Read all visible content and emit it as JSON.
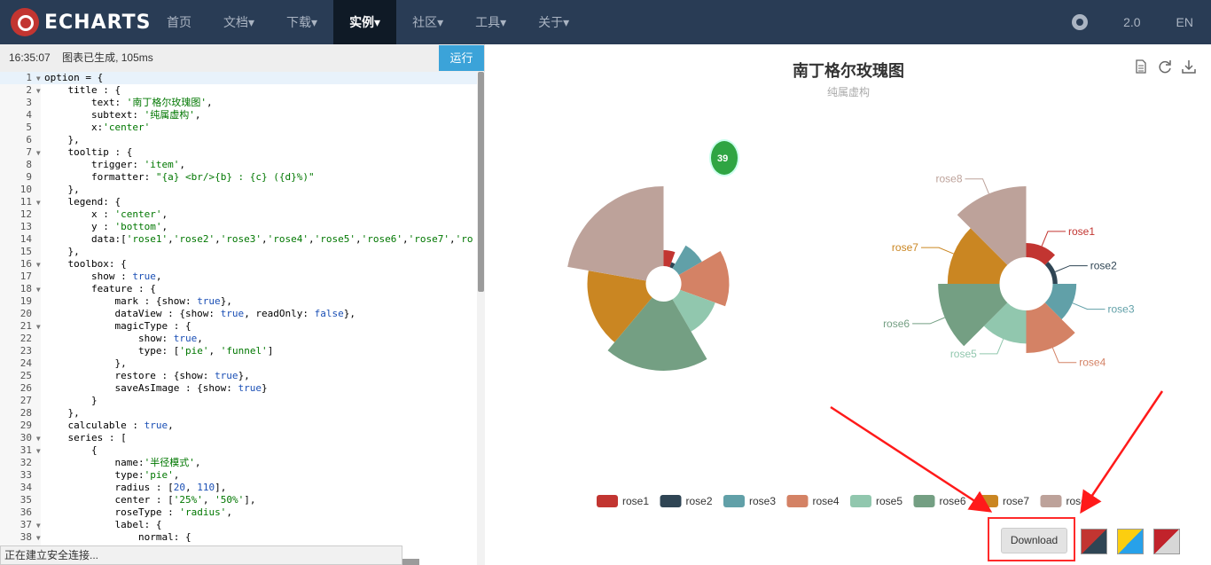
{
  "nav": {
    "logo": "ECHARTS",
    "items": [
      {
        "label": "首页",
        "active": false
      },
      {
        "label": "文档▾",
        "active": false
      },
      {
        "label": "下载▾",
        "active": false
      },
      {
        "label": "实例▾",
        "active": true
      },
      {
        "label": "社区▾",
        "active": false
      },
      {
        "label": "工具▾",
        "active": false
      },
      {
        "label": "关于▾",
        "active": false
      }
    ],
    "version": "2.0",
    "lang": "EN"
  },
  "editor": {
    "time": "16:35:07",
    "status": "图表已生成, 105ms",
    "run_label": "运行",
    "lines": [
      {
        "n": "1",
        "fold": true,
        "html": "option = {"
      },
      {
        "n": "2",
        "fold": true,
        "html": "    title : {"
      },
      {
        "n": "3",
        "fold": false,
        "html": "        text: <span class='s'>'南丁格尔玫瑰图'</span>,"
      },
      {
        "n": "4",
        "fold": false,
        "html": "        subtext: <span class='s'>'纯属虚构'</span>,"
      },
      {
        "n": "5",
        "fold": false,
        "html": "        x:<span class='s'>'center'</span>"
      },
      {
        "n": "6",
        "fold": false,
        "html": "    },"
      },
      {
        "n": "7",
        "fold": true,
        "html": "    tooltip : {"
      },
      {
        "n": "8",
        "fold": false,
        "html": "        trigger: <span class='s'>'item'</span>,"
      },
      {
        "n": "9",
        "fold": false,
        "html": "        formatter: <span class='s'>\"{a} &lt;br/&gt;{b} : {c} ({d}%)\"</span>"
      },
      {
        "n": "10",
        "fold": false,
        "html": "    },"
      },
      {
        "n": "11",
        "fold": true,
        "html": "    legend: {"
      },
      {
        "n": "12",
        "fold": false,
        "html": "        x : <span class='s'>'center'</span>,"
      },
      {
        "n": "13",
        "fold": false,
        "html": "        y : <span class='s'>'bottom'</span>,"
      },
      {
        "n": "14",
        "fold": false,
        "html": "        data:[<span class='s'>'rose1'</span>,<span class='s'>'rose2'</span>,<span class='s'>'rose3'</span>,<span class='s'>'rose4'</span>,<span class='s'>'rose5'</span>,<span class='s'>'rose6'</span>,<span class='s'>'rose7'</span>,<span class='s'>'ro</span>"
      },
      {
        "n": "15",
        "fold": false,
        "html": "    },"
      },
      {
        "n": "16",
        "fold": true,
        "html": "    toolbox: {"
      },
      {
        "n": "17",
        "fold": false,
        "html": "        show : <span class='b'>true</span>,"
      },
      {
        "n": "18",
        "fold": true,
        "html": "        feature : {"
      },
      {
        "n": "19",
        "fold": false,
        "html": "            mark : {show: <span class='b'>true</span>},"
      },
      {
        "n": "20",
        "fold": false,
        "html": "            dataView : {show: <span class='b'>true</span>, readOnly: <span class='b'>false</span>},"
      },
      {
        "n": "21",
        "fold": true,
        "html": "            magicType : {"
      },
      {
        "n": "22",
        "fold": false,
        "html": "                show: <span class='b'>true</span>,"
      },
      {
        "n": "23",
        "fold": false,
        "html": "                type: [<span class='s'>'pie'</span>, <span class='s'>'funnel'</span>]"
      },
      {
        "n": "24",
        "fold": false,
        "html": "            },"
      },
      {
        "n": "25",
        "fold": false,
        "html": "            restore : {show: <span class='b'>true</span>},"
      },
      {
        "n": "26",
        "fold": false,
        "html": "            saveAsImage : {show: <span class='b'>true</span>}"
      },
      {
        "n": "27",
        "fold": false,
        "html": "        }"
      },
      {
        "n": "28",
        "fold": false,
        "html": "    },"
      },
      {
        "n": "29",
        "fold": false,
        "html": "    calculable : <span class='b'>true</span>,"
      },
      {
        "n": "30",
        "fold": true,
        "html": "    series : ["
      },
      {
        "n": "31",
        "fold": true,
        "html": "        {"
      },
      {
        "n": "32",
        "fold": false,
        "html": "            name:<span class='s'>'半径模式'</span>,"
      },
      {
        "n": "33",
        "fold": false,
        "html": "            type:<span class='s'>'pie'</span>,"
      },
      {
        "n": "34",
        "fold": false,
        "html": "            radius : [<span class='b'>20</span>, <span class='b'>110</span>],"
      },
      {
        "n": "35",
        "fold": false,
        "html": "            center : [<span class='s'>'25%'</span>, <span class='s'>'50%'</span>],"
      },
      {
        "n": "36",
        "fold": false,
        "html": "            roseType : <span class='s'>'radius'</span>,"
      },
      {
        "n": "37",
        "fold": true,
        "html": "            label: {"
      },
      {
        "n": "38",
        "fold": true,
        "html": "                normal: {"
      }
    ]
  },
  "browser_status": "正在建立安全连接...",
  "chart_data": {
    "type": "pie",
    "title": "南丁格尔玫瑰图",
    "subtitle": "纯属虚构",
    "categories": [
      "rose1",
      "rose2",
      "rose3",
      "rose4",
      "rose5",
      "rose6",
      "rose7",
      "rose8"
    ],
    "values": [
      10,
      5,
      15,
      25,
      20,
      35,
      30,
      40
    ],
    "colors": [
      "#c23531",
      "#2f4554",
      "#61a0a8",
      "#d48265",
      "#91c7ae",
      "#749f83",
      "#ca8622",
      "#bda29a"
    ],
    "series": [
      {
        "name": "",
        "roseType": "radius",
        "radius": [
          20,
          110
        ],
        "center": [
          "25%",
          "50%"
        ],
        "show_labels": false
      },
      {
        "name": "",
        "roseType": "area",
        "radius": [
          30,
          110
        ],
        "center": [
          "75%",
          "50%"
        ],
        "show_labels": true
      }
    ],
    "legend_placement": "bottom-center"
  },
  "badge_text": "39",
  "download_label": "Download",
  "swatches": [
    {
      "a": "#c23531",
      "b": "#2f4554"
    },
    {
      "a": "#fcce10",
      "b": "#27a1ea"
    },
    {
      "a": "#c1232b",
      "b": "#d7d7d7"
    }
  ]
}
